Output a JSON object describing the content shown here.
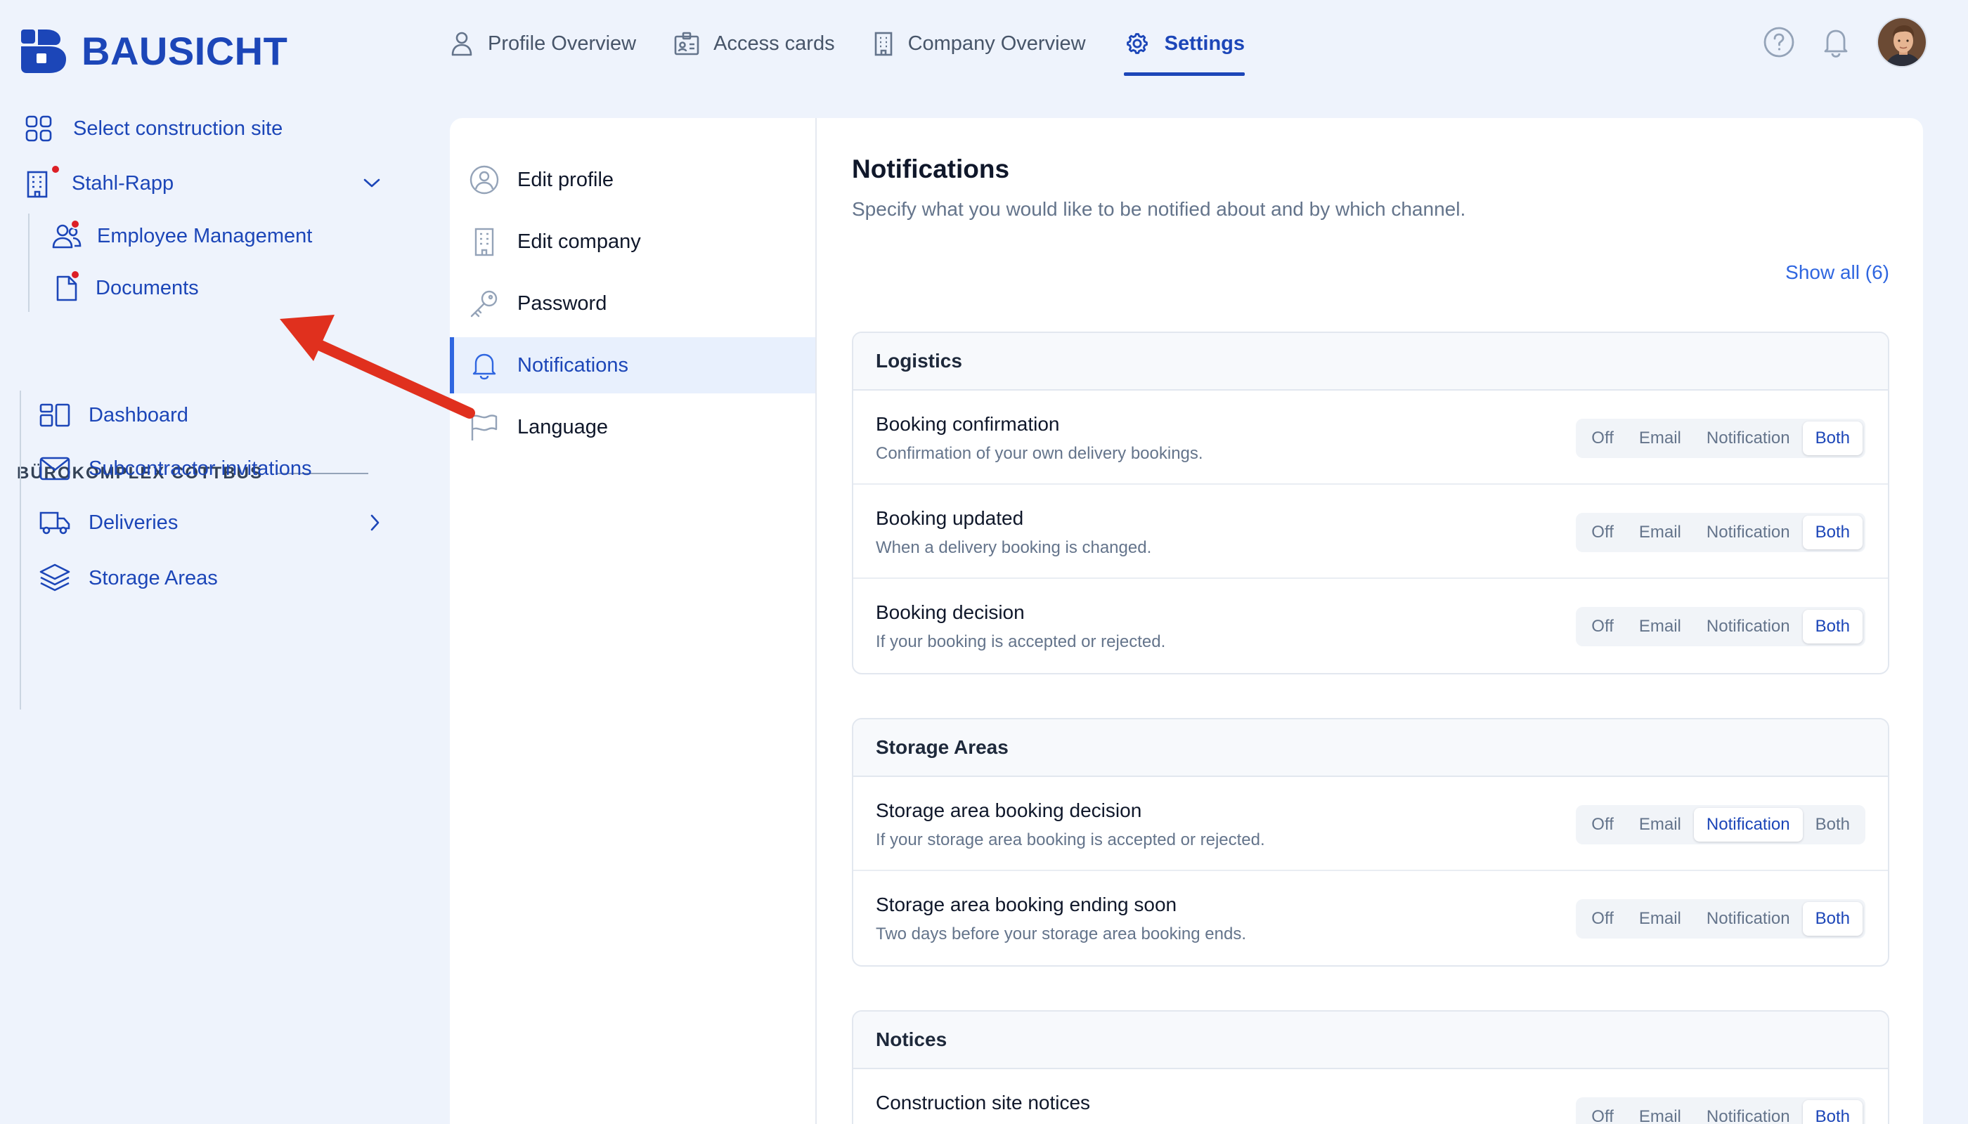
{
  "app": {
    "brand": "BAUSICHT"
  },
  "topnav": {
    "items": [
      {
        "label": "Profile Overview",
        "icon": "user-icon"
      },
      {
        "label": "Access cards",
        "icon": "id-card-icon"
      },
      {
        "label": "Company Overview",
        "icon": "building-icon"
      },
      {
        "label": "Settings",
        "icon": "gear-icon",
        "active": true
      }
    ]
  },
  "topright": {
    "help_icon": "help-circle-icon",
    "bell_icon": "bell-icon"
  },
  "sidebar": {
    "select_site": "Select construction site",
    "company": "Stahl-Rapp",
    "company_items": [
      "Employee Management",
      "Documents"
    ],
    "section_title": "BÜROKOMPLEX COTTBUS",
    "section_items": [
      "Dashboard",
      "Subcontractor invitations",
      "Deliveries",
      "Storage Areas"
    ]
  },
  "settings_menu": {
    "items": [
      {
        "label": "Edit profile",
        "icon": "user-circle-icon"
      },
      {
        "label": "Edit company",
        "icon": "building-icon"
      },
      {
        "label": "Password",
        "icon": "key-icon"
      },
      {
        "label": "Notifications",
        "icon": "bell-icon",
        "active": true
      },
      {
        "label": "Language",
        "icon": "flag-icon"
      }
    ]
  },
  "notifications": {
    "title": "Notifications",
    "description": "Specify what you would like to be notified about and by which channel.",
    "show_all": "Show all (6)",
    "options": [
      "Off",
      "Email",
      "Notification",
      "Both"
    ],
    "groups": [
      {
        "title": "Logistics",
        "rows": [
          {
            "title": "Booking confirmation",
            "subtitle": "Confirmation of your own delivery bookings.",
            "selected": "Both"
          },
          {
            "title": "Booking updated",
            "subtitle": "When a delivery booking is changed.",
            "selected": "Both"
          },
          {
            "title": "Booking decision",
            "subtitle": "If your booking is accepted or rejected.",
            "selected": "Both"
          }
        ]
      },
      {
        "title": "Storage Areas",
        "rows": [
          {
            "title": "Storage area booking decision",
            "subtitle": "If your storage area booking is accepted or rejected.",
            "selected": "Notification"
          },
          {
            "title": "Storage area booking ending soon",
            "subtitle": "Two days before your storage area booking ends.",
            "selected": "Both"
          }
        ]
      },
      {
        "title": "Notices",
        "rows": [
          {
            "title": "Construction site notices",
            "subtitle": "",
            "selected": "Both"
          }
        ]
      }
    ]
  },
  "colors": {
    "brand": "#1c46b8",
    "accent": "#2f66e0",
    "alert": "#dc1f26",
    "annotation_arrow": "#e0301e"
  }
}
